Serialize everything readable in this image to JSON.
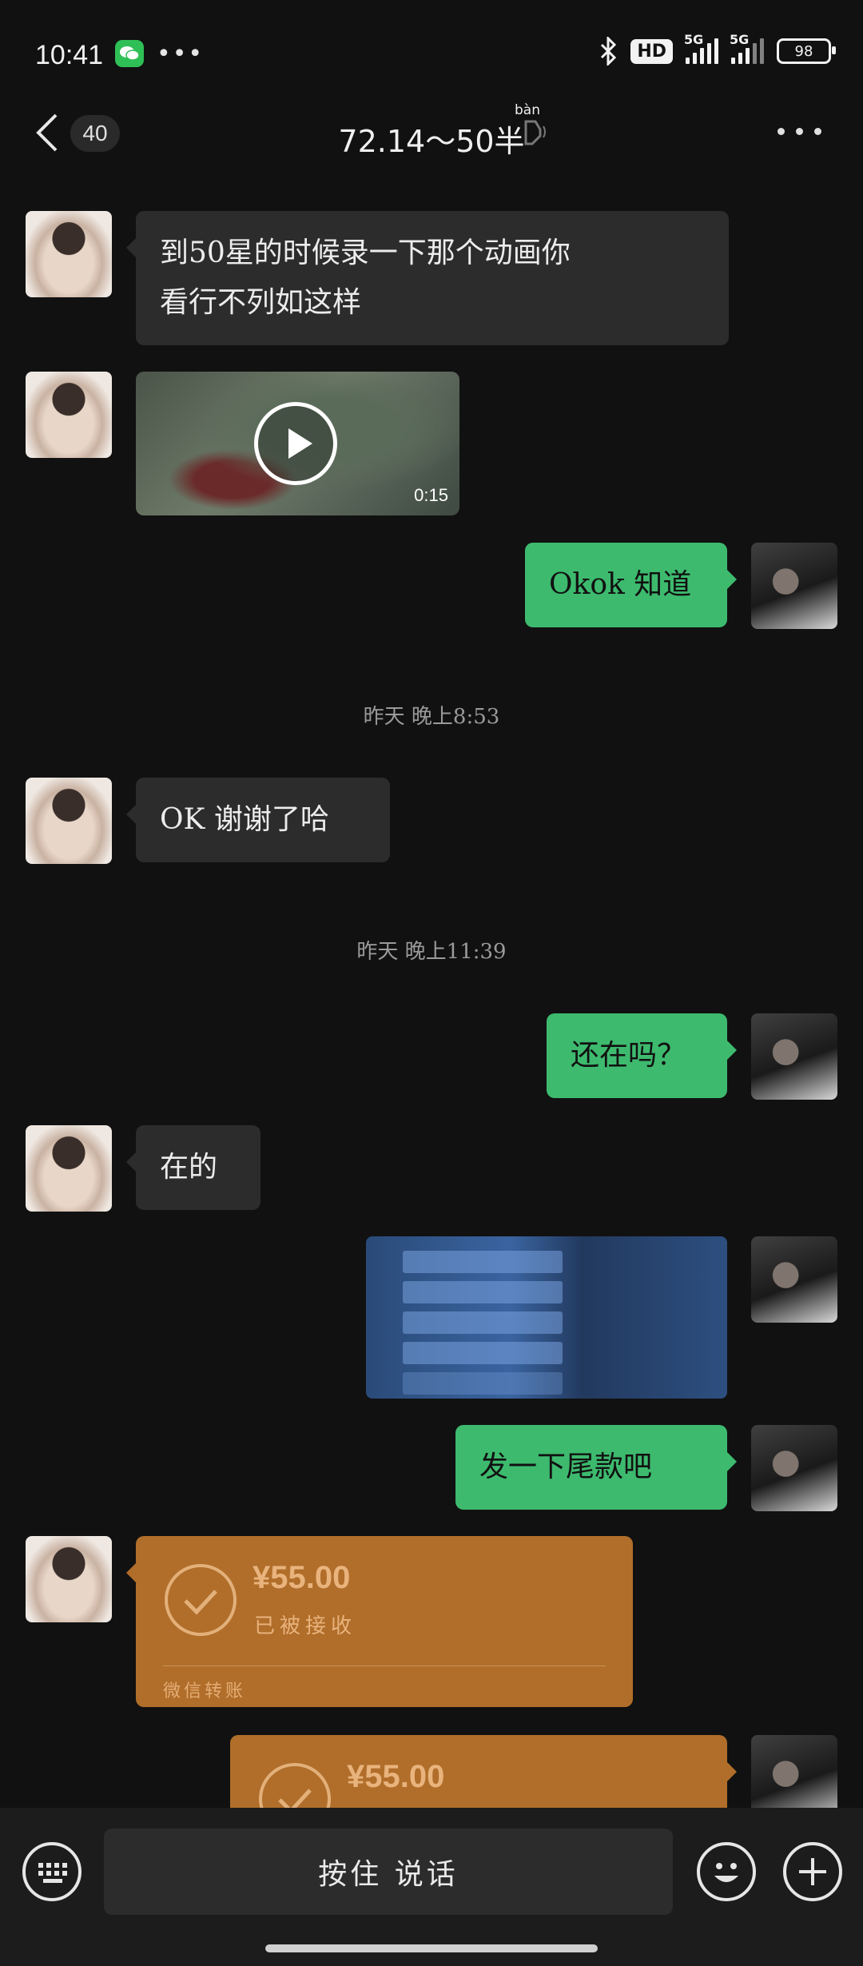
{
  "status_bar": {
    "time": "10:41",
    "net1": "5G",
    "net2": "5G",
    "hd": "HD",
    "battery": "98"
  },
  "header": {
    "unread_count": "40",
    "title": "72.14～50半",
    "title_pinyin": "bàn"
  },
  "messages": [
    {
      "side": "left",
      "type": "text",
      "lines": [
        "到50星的时候录一下那个动画你",
        "看行不列如这样"
      ]
    },
    {
      "side": "left",
      "type": "video",
      "duration": "0:15"
    },
    {
      "side": "right",
      "type": "text",
      "lines": [
        "Okok 知道"
      ]
    },
    {
      "type": "timestamp",
      "text": "昨天 晚上8:53"
    },
    {
      "side": "left",
      "type": "text",
      "lines": [
        "OK 谢谢了哈"
      ]
    },
    {
      "type": "timestamp",
      "text": "昨天 晚上11:39"
    },
    {
      "side": "right",
      "type": "text",
      "lines": [
        "还在吗？"
      ]
    },
    {
      "side": "left",
      "type": "text",
      "lines": [
        "在的"
      ]
    },
    {
      "side": "right",
      "type": "image"
    },
    {
      "side": "right",
      "type": "text",
      "lines": [
        "发一下尾款吧"
      ]
    },
    {
      "side": "left",
      "type": "transfer",
      "amount": "¥55.00",
      "status": "已被接收",
      "footer": "微信转账"
    },
    {
      "side": "right",
      "type": "transfer",
      "amount": "¥55.00"
    }
  ],
  "input": {
    "hold_to_talk": "按住 说话"
  },
  "icons": [
    "back-icon",
    "voice-icon",
    "more-icon",
    "play-icon",
    "check-icon",
    "keyboard-icon",
    "emoji-icon",
    "plus-icon"
  ],
  "colors": {
    "background": "#111111",
    "bubble_left": "#2c2c2c",
    "bubble_right": "#3dba6e",
    "transfer": "#b06e2a"
  }
}
